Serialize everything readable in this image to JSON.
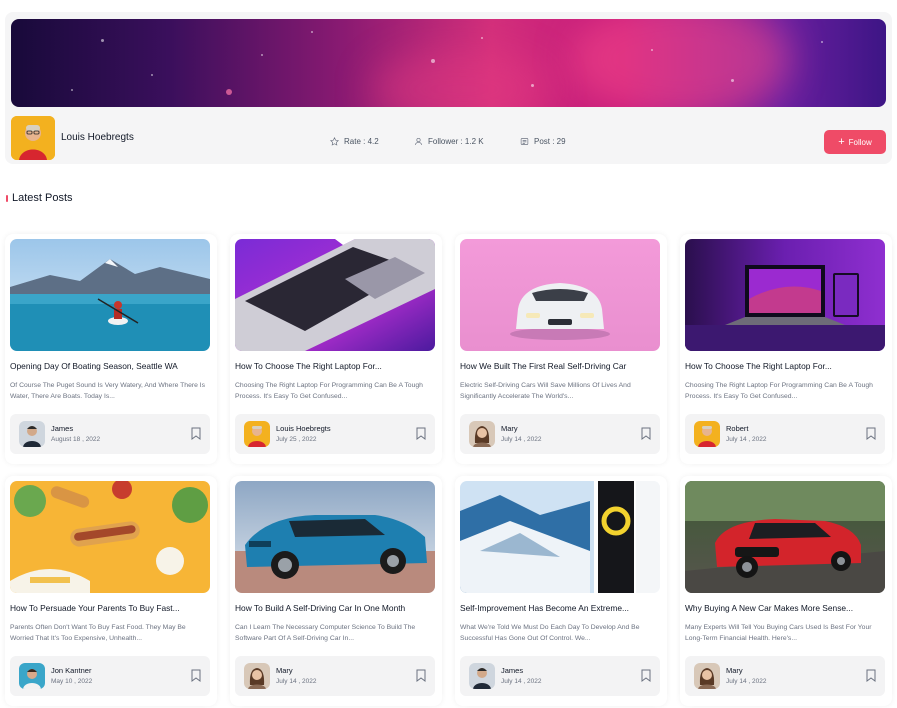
{
  "profile": {
    "name": "Louis Hoebregts",
    "stats": {
      "rate": "Rate : 4.2",
      "follower": "Follower : 1.2 K",
      "post": "Post : 29"
    },
    "follow_button": "Follow"
  },
  "section": {
    "title": "Latest Posts"
  },
  "posts": [
    {
      "title": "Opening Day Of Boating Season, Seattle WA",
      "description": "Of Course The Puget Sound Is Very Watery, And Where There Is Water, There Are Boats. Today Is...",
      "author": "James",
      "date": "August 18 , 2022"
    },
    {
      "title": "How To Choose The Right Laptop For...",
      "description": "Choosing The Right Laptop For Programming Can Be A Tough Process. It's Easy To Get Confused...",
      "author": "Louis Hoebregts",
      "date": "July 25 , 2022"
    },
    {
      "title": "How We Built The First Real Self-Driving Car",
      "description": "Electric Self-Driving Cars Will Save Millions Of Lives And Significantly Accelerate The World's...",
      "author": "Mary",
      "date": "July 14 , 2022"
    },
    {
      "title": "How To Choose The Right Laptop For...",
      "description": "Choosing The Right Laptop For Programming Can Be A Tough Process. It's Easy To Get Confused...",
      "author": "Robert",
      "date": "July 14 , 2022"
    },
    {
      "title": "How To Persuade Your Parents To Buy Fast...",
      "description": "Parents Often Don't Want To Buy Fast Food. They May Be Worried That It's Too Expensive, Unhealth...",
      "author": "Jon Kantner",
      "date": "May 10 , 2022"
    },
    {
      "title": "How To Build A Self-Driving Car In One Month",
      "description": "Can I Learn The Necessary Computer Science To Build The Software Part Of A Self-Driving Car In...",
      "author": "Mary",
      "date": "July 14 , 2022"
    },
    {
      "title": "Self-Improvement Has Become An Extreme...",
      "description": "What We're Told We Must Do Each Day To Develop And Be Successful Has Gone Out Of Control. We...",
      "author": "James",
      "date": "July 14 , 2022"
    },
    {
      "title": "Why Buying A New Car Makes More Sense...",
      "description": "Many Experts Will Tell You Buying Cars Used Is Best For Your Long-Term Financial Health. Here's...",
      "author": "Mary",
      "date": "July 14 , 2022"
    }
  ],
  "colors": {
    "accent": "#ef4b67",
    "card_bg": "#ffffff",
    "footer_bg": "#f3f3f4"
  }
}
